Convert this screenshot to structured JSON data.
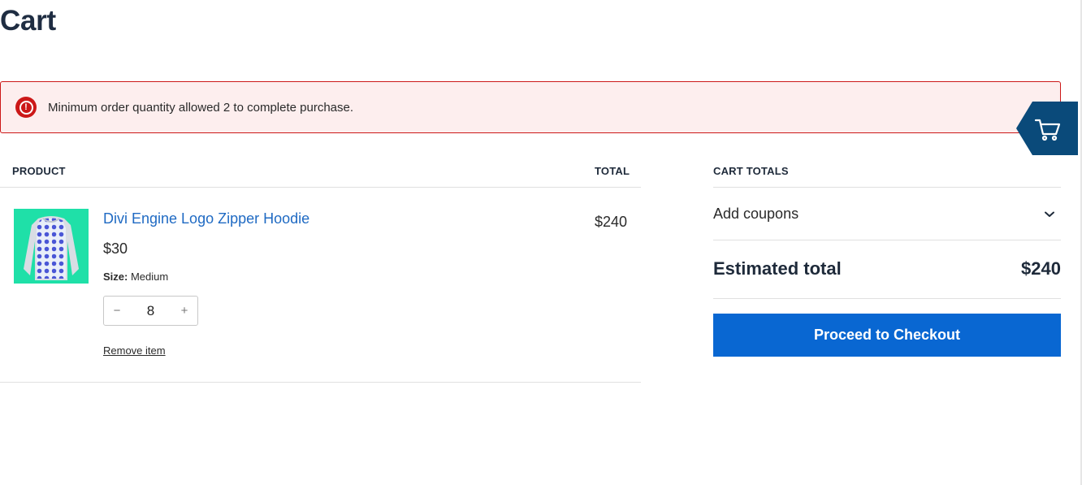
{
  "page": {
    "title": "Cart"
  },
  "notice": {
    "text": "Minimum order quantity allowed 2 to complete purchase.",
    "icon": "error-icon",
    "color": "#cc1818",
    "background": "#fdeeee"
  },
  "cart_table": {
    "headers": {
      "product": "PRODUCT",
      "total": "TOTAL"
    },
    "items": [
      {
        "name": "Divi Engine Logo Zipper Hoodie",
        "unit_price": "$30",
        "attribute_label": "Size:",
        "attribute_value": "Medium",
        "quantity": "8",
        "line_total": "$240",
        "remove_label": "Remove item",
        "thumbnail": "hoodie-image"
      }
    ]
  },
  "totals": {
    "heading": "CART TOTALS",
    "coupons_label": "Add coupons",
    "estimated_label": "Estimated total",
    "estimated_value": "$240",
    "checkout_label": "Proceed to Checkout"
  },
  "colors": {
    "link": "#1f6ac3",
    "checkout_button": "#0967d2",
    "mini_cart_badge": "#0a4a7a",
    "thumbnail_bg": "#1fe0a8"
  }
}
